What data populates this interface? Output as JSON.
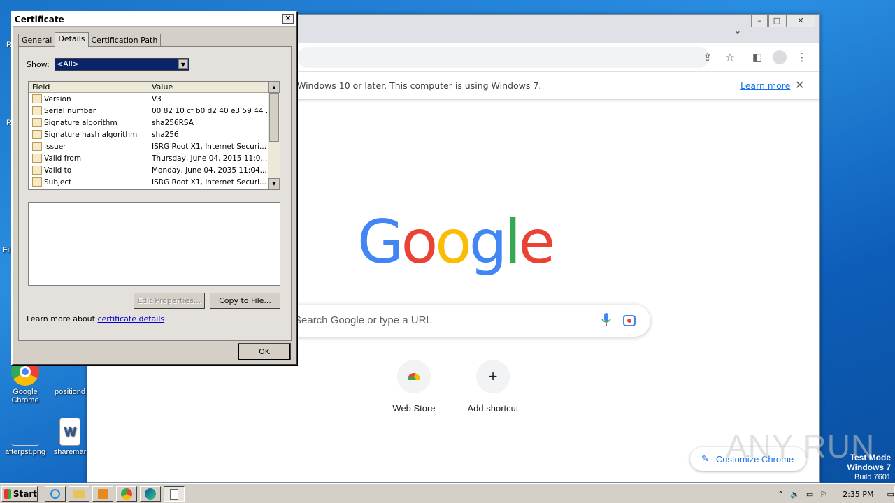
{
  "desktop": {
    "icons": [
      {
        "label": "Google Chrome"
      },
      {
        "label": "positiond"
      },
      {
        "label": "afterpst.png"
      },
      {
        "label": "sharemar"
      }
    ],
    "edge_fragments": [
      "R",
      "R",
      "Fil"
    ]
  },
  "chrome": {
    "infobar": {
      "message": "Windows 10 or later. This computer is using Windows 7.",
      "learn_more": "Learn more"
    },
    "logo": [
      "G",
      "o",
      "o",
      "g",
      "l",
      "e"
    ],
    "logo_colors": [
      "#4285f4",
      "#ea4335",
      "#fbbc05",
      "#4285f4",
      "#34a853",
      "#ea4335"
    ],
    "search_placeholder": "Search Google or type a URL",
    "shortcuts": [
      {
        "label": "Web Store",
        "icon": "web-store-icon"
      },
      {
        "label": "Add shortcut",
        "icon": "plus-icon",
        "glyph": "+"
      }
    ],
    "customize": "Customize Chrome",
    "window_controls": [
      "–",
      "□",
      "✕"
    ]
  },
  "watermark": "ANY RUN",
  "test_mode": {
    "line1": "Test Mode",
    "line2": "Windows 7",
    "line3": "Build 7601"
  },
  "certificate": {
    "title": "Certificate",
    "tabs": [
      "General",
      "Details",
      "Certification Path"
    ],
    "active_tab": "Details",
    "show_label": "Show:",
    "show_value": "<All>",
    "columns": [
      "Field",
      "Value"
    ],
    "rows": [
      {
        "field": "Version",
        "value": "V3"
      },
      {
        "field": "Serial number",
        "value": "00 82 10 cf b0 d2 40 e3 59 44 ..."
      },
      {
        "field": "Signature algorithm",
        "value": "sha256RSA"
      },
      {
        "field": "Signature hash algorithm",
        "value": "sha256"
      },
      {
        "field": "Issuer",
        "value": "ISRG Root X1, Internet Securi..."
      },
      {
        "field": "Valid from",
        "value": "Thursday, June 04, 2015 11:0..."
      },
      {
        "field": "Valid to",
        "value": "Monday, June 04, 2035 11:04..."
      },
      {
        "field": "Subject",
        "value": "ISRG Root X1, Internet Securi..."
      }
    ],
    "edit_properties": "Edit Properties...",
    "copy_to_file": "Copy to File...",
    "learn_more_prefix": "Learn more about ",
    "learn_more_link": "certificate details",
    "ok": "OK"
  },
  "taskbar": {
    "start": "Start",
    "clock": "2:35 PM"
  }
}
